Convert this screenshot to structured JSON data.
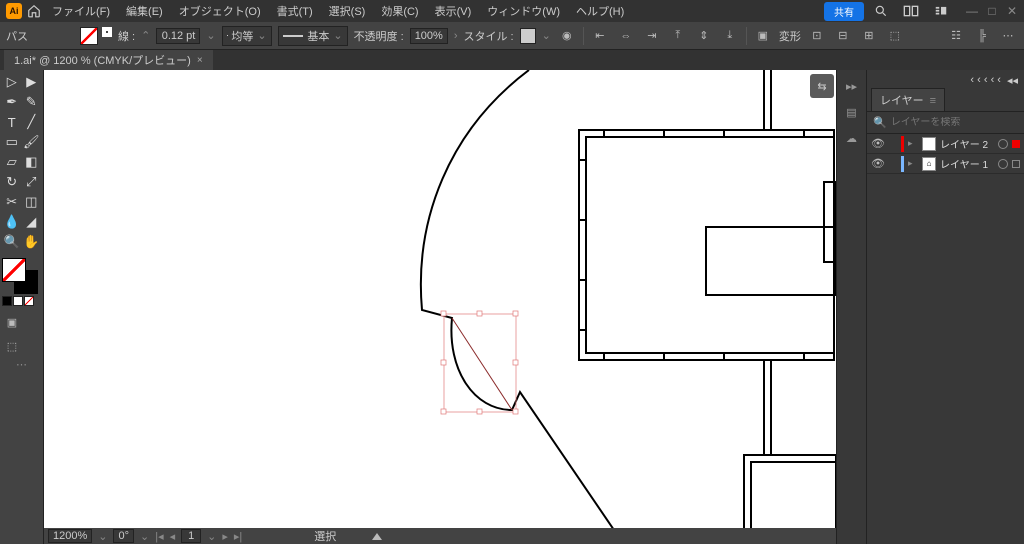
{
  "menu": {
    "file": "ファイル(F)",
    "edit": "編集(E)",
    "object": "オブジェクト(O)",
    "format": "書式(T)",
    "select": "選択(S)",
    "effect": "効果(C)",
    "view": "表示(V)",
    "window": "ウィンドウ(W)",
    "help": "ヘルプ(H)",
    "share": "共有"
  },
  "ctrl": {
    "path": "パス",
    "stroke_lbl": "線 :",
    "stroke_val": "0.12 pt",
    "even": "均等",
    "basic": "基本",
    "opacity_lbl": "不透明度 :",
    "opacity_val": "100%",
    "style_lbl": "スタイル :",
    "transform": "変形"
  },
  "tab": {
    "title": "1.ai* @ 1200 % (CMYK/プレビュー)"
  },
  "status": {
    "zoom": "1200%",
    "rot": "0°",
    "art": "1",
    "sel": "選択"
  },
  "panel": {
    "title": "レイヤー",
    "search_ph": "レイヤーを検索",
    "layer2": "レイヤー 2",
    "layer1": "レイヤー 1"
  }
}
